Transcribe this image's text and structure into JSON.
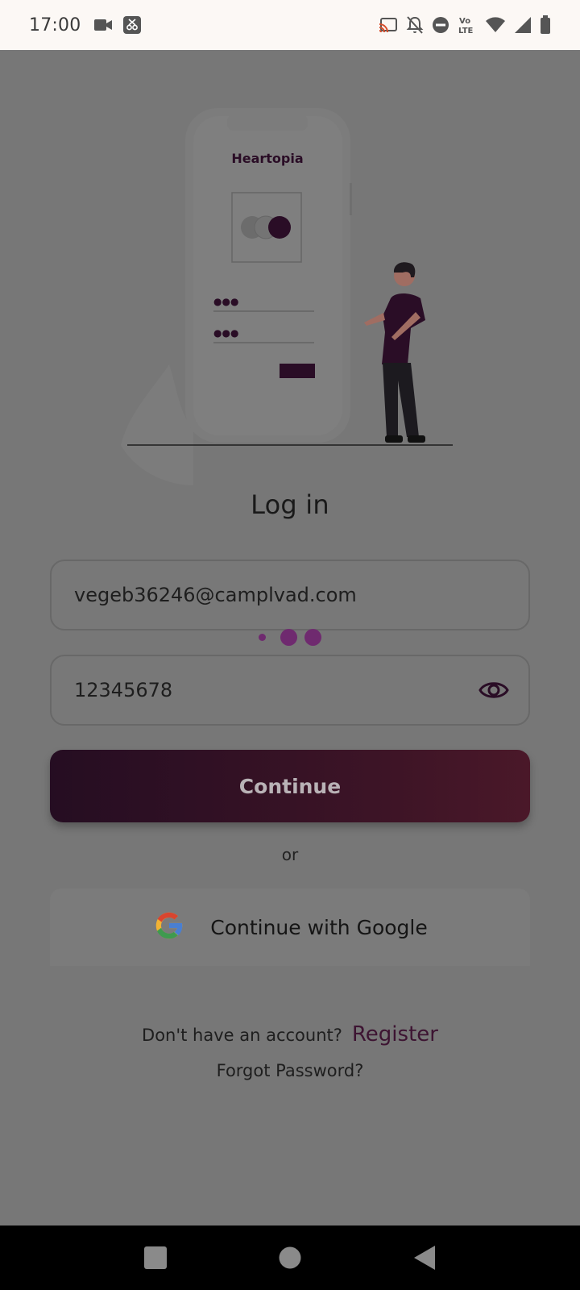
{
  "status_bar": {
    "time": "17:00",
    "left_icons": [
      "video-camera-icon",
      "screen-recorder-icon"
    ],
    "right_icons": [
      "cast-icon",
      "notifications-off-icon",
      "do-not-disturb-icon",
      "volte-icon",
      "wifi-icon",
      "signal-icon",
      "battery-icon"
    ],
    "volte_text_top": "Vo",
    "volte_text_bottom": "LTE"
  },
  "illustration": {
    "brand_name": "Heartopia",
    "pin_dots": "●●●"
  },
  "login": {
    "title": "Log in",
    "email_value": "vegeb36246@camplvad.com",
    "password_value": "12345678",
    "continue_label": "Continue",
    "or_label": "or",
    "google_label": "Continue with Google",
    "register_prompt": "Don't have an account?",
    "register_label": "Register",
    "forgot_label": "Forgot Password?"
  },
  "colors": {
    "brand_dark": "#2a0d26",
    "overlay": "#777777",
    "loading_dot": "#6f2a6f"
  },
  "nav_bar": {
    "icons": [
      "recents-square-icon",
      "home-circle-icon",
      "back-triangle-icon"
    ]
  }
}
